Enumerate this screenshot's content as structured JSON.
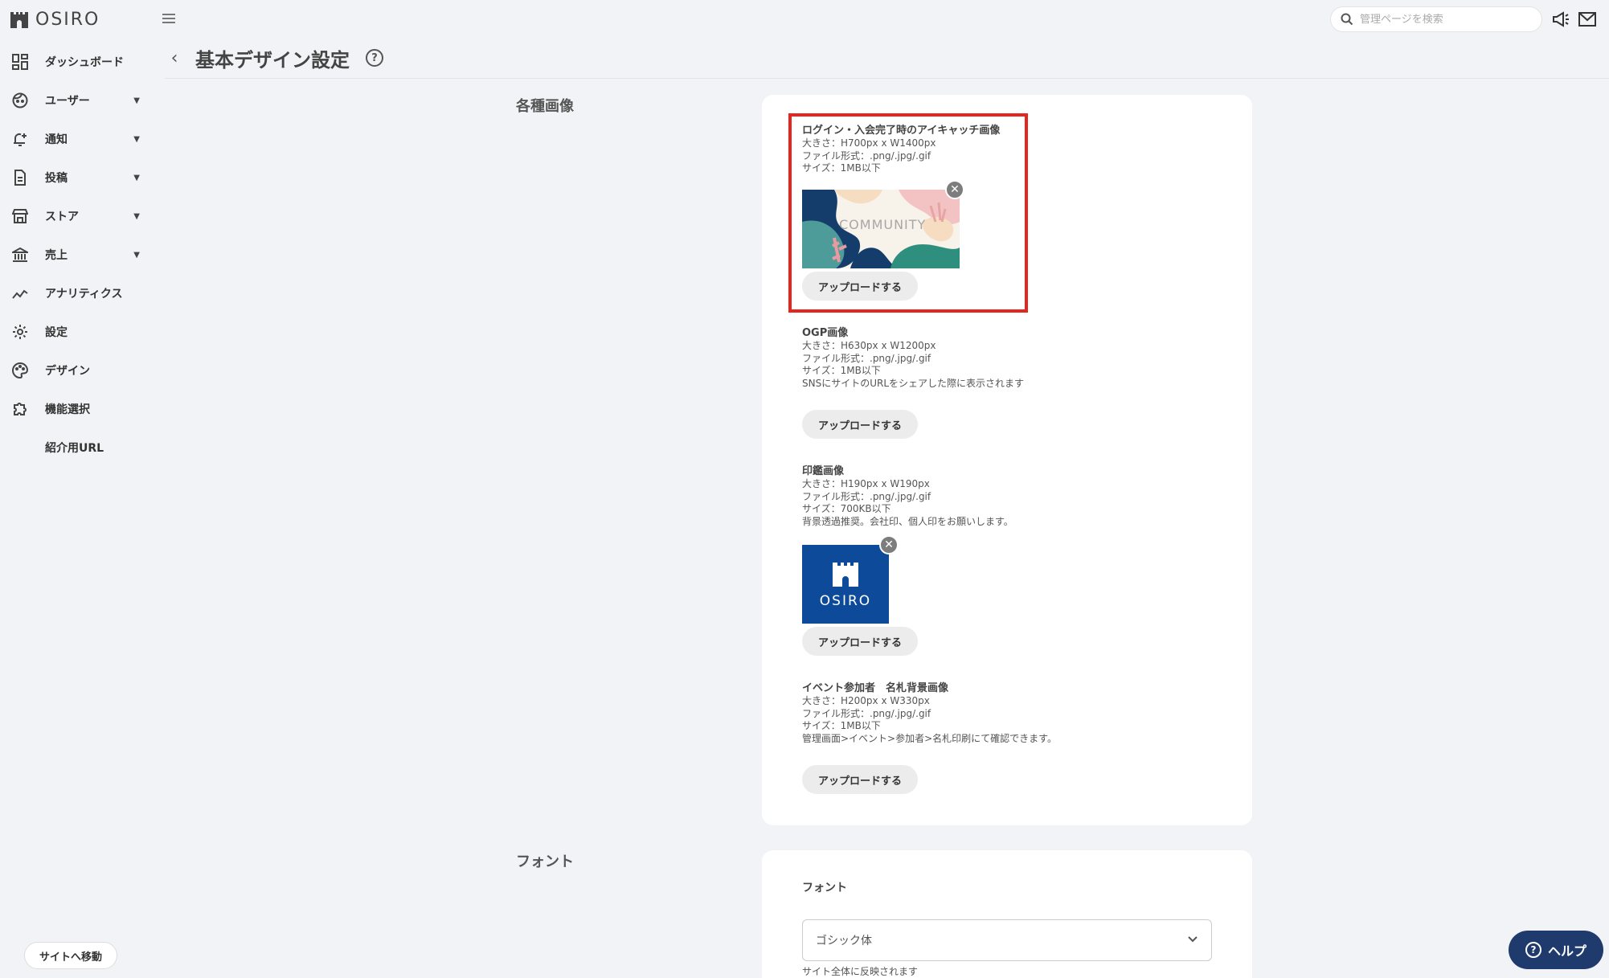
{
  "app": {
    "name": "OSIRO"
  },
  "sidebar": {
    "items": [
      {
        "label": "ダッシュボード",
        "icon": "dashboard-icon",
        "has_caret": false
      },
      {
        "label": "ユーザー",
        "icon": "user-face-icon",
        "has_caret": true
      },
      {
        "label": "通知",
        "icon": "bell-plus-icon",
        "has_caret": true
      },
      {
        "label": "投稿",
        "icon": "document-icon",
        "has_caret": true
      },
      {
        "label": "ストア",
        "icon": "store-icon",
        "has_caret": true
      },
      {
        "label": "売上",
        "icon": "bank-icon",
        "has_caret": true
      },
      {
        "label": "アナリティクス",
        "icon": "analytics-icon",
        "has_caret": false
      },
      {
        "label": "設定",
        "icon": "gear-icon",
        "has_caret": false
      },
      {
        "label": "デザイン",
        "icon": "palette-icon",
        "has_caret": false
      },
      {
        "label": "機能選択",
        "icon": "puzzle-icon",
        "has_caret": false
      },
      {
        "label": "紹介用URL",
        "icon": "",
        "has_caret": false
      }
    ],
    "site_button": "サイトへ移動"
  },
  "topbar": {
    "search_placeholder": "管理ページを検索"
  },
  "page": {
    "title": "基本デザイン設定"
  },
  "sections": {
    "images_label": "各種画像",
    "font_label": "フォント"
  },
  "images": {
    "upload_label": "アップロードする",
    "login": {
      "title": "ログイン・入会完了時のアイキャッチ画像",
      "lines": [
        "大きさ：H700px x W1400px",
        "ファイル形式：.png/.jpg/.gif",
        "サイズ：1MB以下"
      ],
      "thumb_text": "COMMUNITY"
    },
    "ogp": {
      "title": "OGP画像",
      "lines": [
        "大きさ：H630px x W1200px",
        "ファイル形式：.png/.jpg/.gif",
        "サイズ：1MB以下",
        "SNSにサイトのURLをシェアした際に表示されます"
      ]
    },
    "seal": {
      "title": "印鑑画像",
      "lines": [
        "大きさ：H190px x W190px",
        "ファイル形式：.png/.jpg/.gif",
        "サイズ：700KB以下",
        "背景透過推奨。会社印、個人印をお願いします。"
      ],
      "thumb_text": "OSIRO"
    },
    "badge": {
      "title": "イベント参加者　名札背景画像",
      "lines": [
        "大きさ：H200px x W330px",
        "ファイル形式：.png/.jpg/.gif",
        "サイズ：1MB以下",
        "管理画面>イベント>参加者>名札印刷にて確認できます。"
      ]
    }
  },
  "font": {
    "label": "フォント",
    "selected": "ゴシック体",
    "hint": "サイト全体に反映されます"
  },
  "help_button": "ヘルプ",
  "colors": {
    "background": "#f1f3f6",
    "highlight": "#e5261f",
    "help_button": "#1f3b6e",
    "seal_blue": "#0d4a9a"
  }
}
